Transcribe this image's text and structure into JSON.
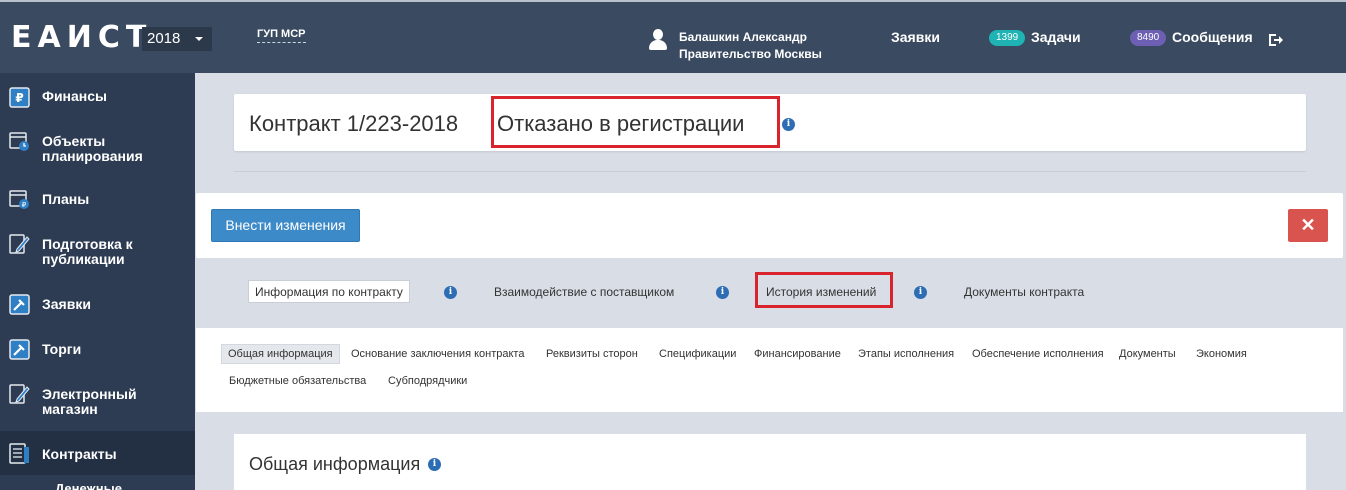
{
  "header": {
    "logo": "ЕАИСТ",
    "year": "2018",
    "org": "ГУП МСР",
    "user_name": "Балашкин Александр",
    "user_org": "Правительство Москвы",
    "nav_requests": "Заявки",
    "tasks_badge": "1399",
    "nav_tasks": "Задачи",
    "messages_badge": "8490",
    "nav_messages": "Сообщения"
  },
  "sidebar": {
    "items": [
      {
        "label": "Финансы"
      },
      {
        "label": "Объекты планирования"
      },
      {
        "label": "Планы"
      },
      {
        "label": "Подготовка к публикации"
      },
      {
        "label": "Заявки"
      },
      {
        "label": "Торги"
      },
      {
        "label": "Электронный магазин"
      },
      {
        "label": "Контракты"
      }
    ],
    "sub_item": "Денежные"
  },
  "contract": {
    "title": "Контракт 1/223-2018",
    "status": "Отказано в регистрации"
  },
  "actions": {
    "change_label": "Внести изменения",
    "close_label": "✕"
  },
  "tabs": [
    {
      "label": "Информация по контракту"
    },
    {
      "label": "Взаимодействие с поставщиком"
    },
    {
      "label": "История изменений"
    },
    {
      "label": "Документы контракта"
    }
  ],
  "subtabs": [
    {
      "label": "Общая информация"
    },
    {
      "label": "Основание заключения контракта"
    },
    {
      "label": "Реквизиты сторон"
    },
    {
      "label": "Спецификации"
    },
    {
      "label": "Финансирование"
    },
    {
      "label": "Этапы исполнения"
    },
    {
      "label": "Обеспечение исполнения"
    },
    {
      "label": "Документы"
    },
    {
      "label": "Экономия"
    },
    {
      "label": "Бюджетные обязательства"
    },
    {
      "label": "Субподрядчики"
    }
  ],
  "section": {
    "title": "Общая информация"
  },
  "colors": {
    "topbar": "#3a4a60",
    "sidebar": "#2d3c52",
    "primary_button": "#3d8ac9",
    "danger_button": "#d9534f",
    "highlight_box": "#d9232d",
    "tasks_badge": "#1fb3b3",
    "messages_badge": "#6d5fb3"
  }
}
